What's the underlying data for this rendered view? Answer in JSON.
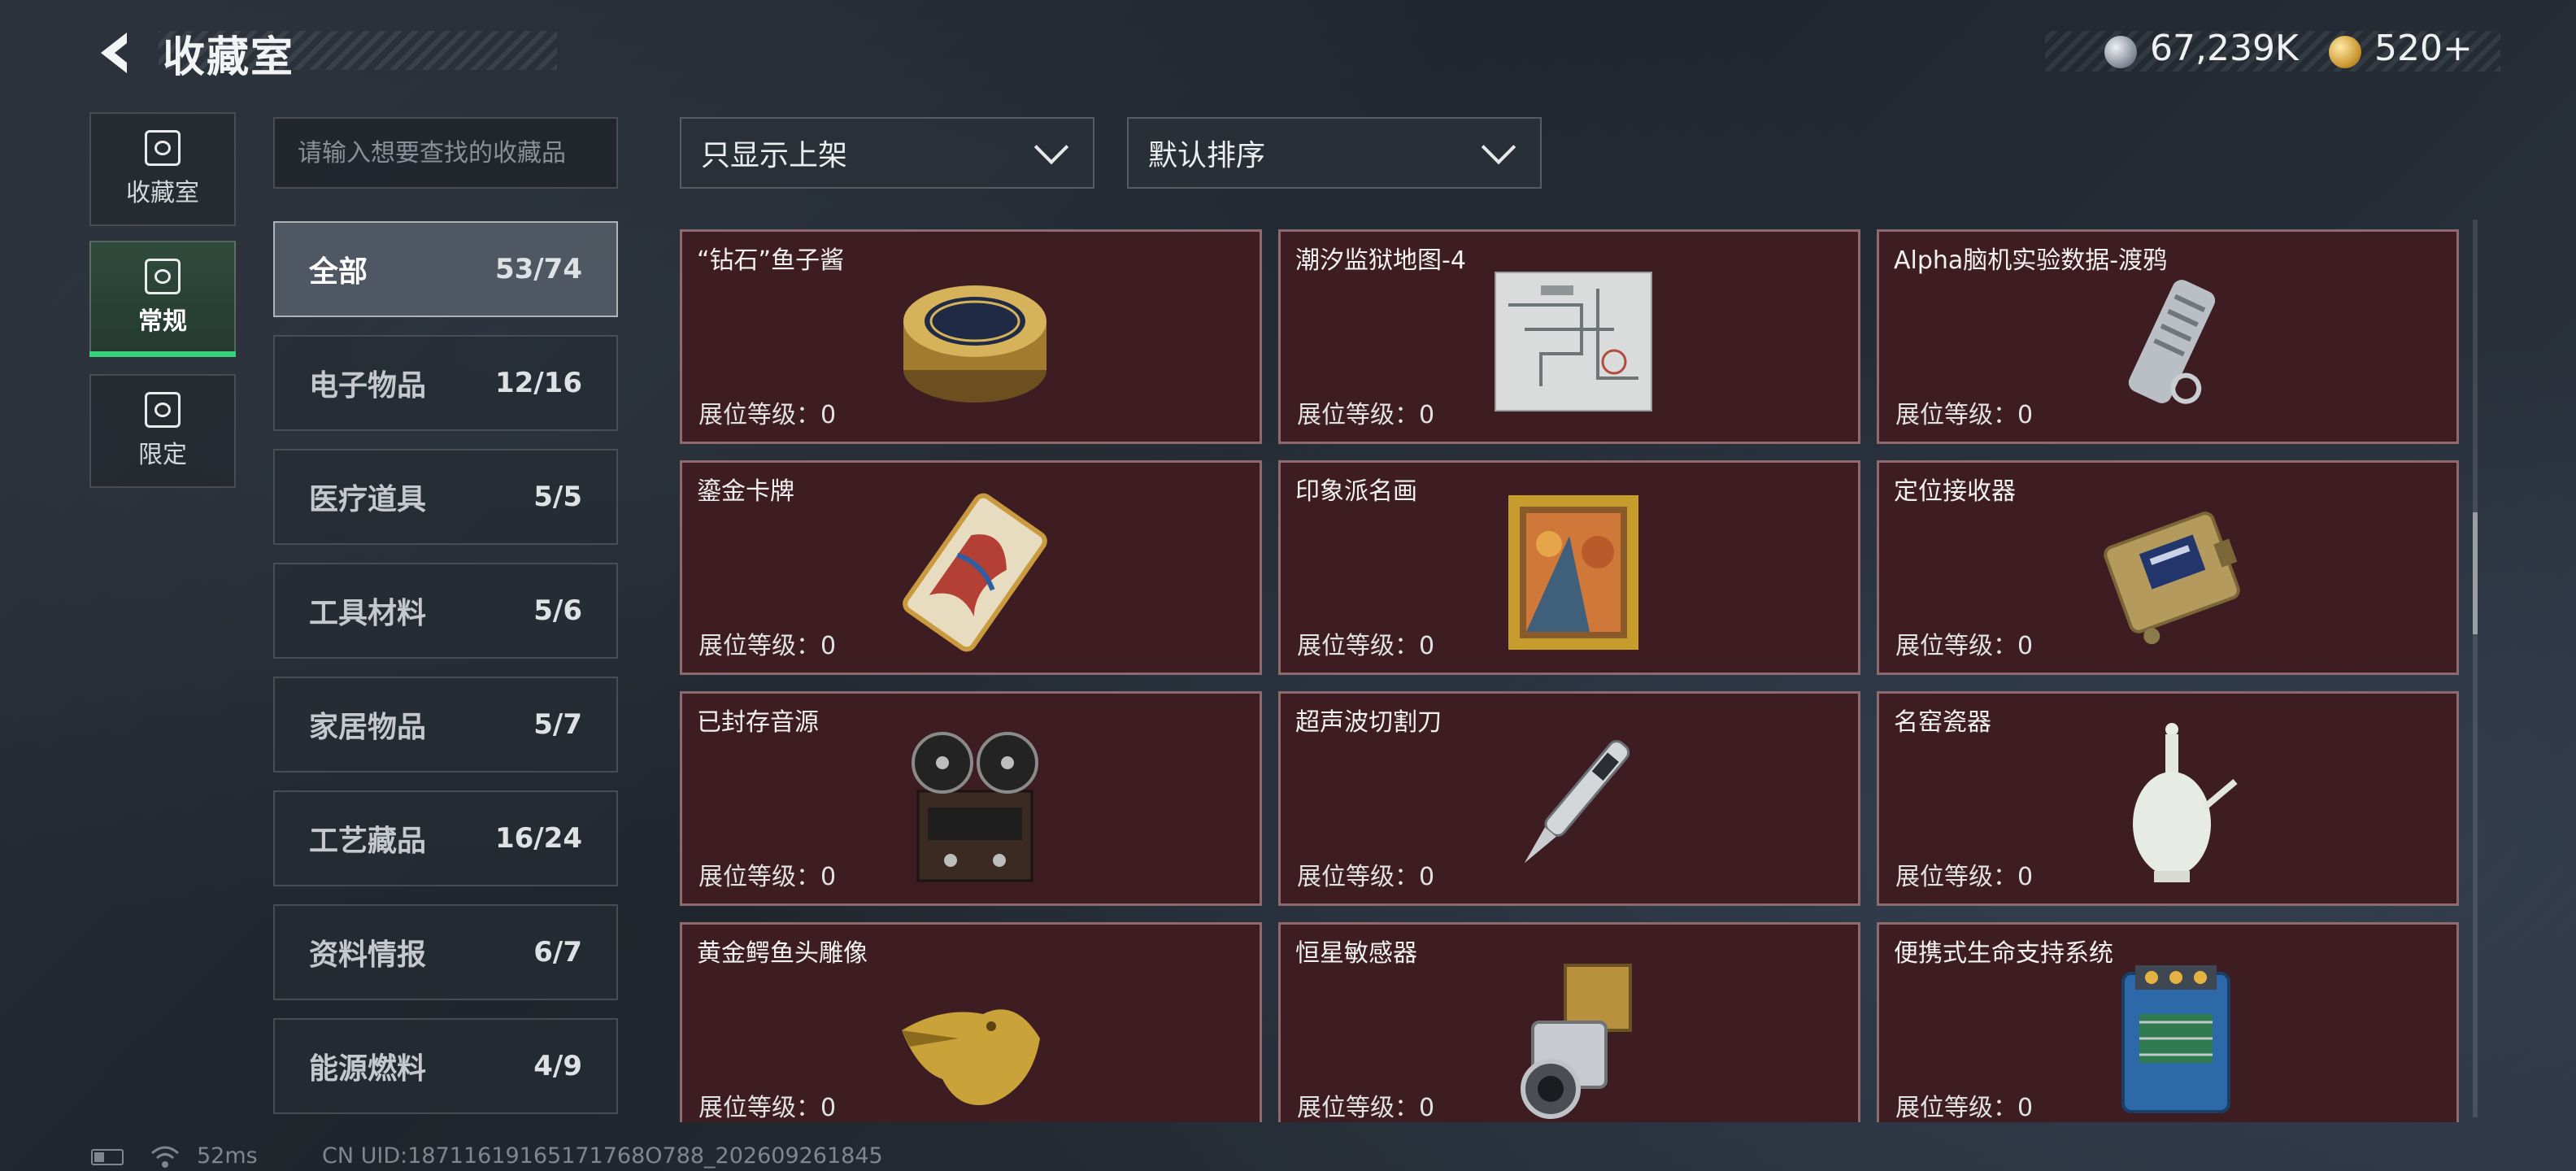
{
  "header": {
    "title": "收藏室",
    "currency": [
      {
        "icon": "silver-coin-icon",
        "value": "67,239K"
      },
      {
        "icon": "gold-coin-icon",
        "value": "520+"
      }
    ]
  },
  "nav": {
    "items": [
      {
        "label": "收藏室",
        "icon": "collection-room-icon"
      },
      {
        "label": "常规",
        "icon": "regular-icon",
        "active": true
      },
      {
        "label": "限定",
        "icon": "limited-icon"
      }
    ]
  },
  "search": {
    "placeholder": "请输入想要查找的收藏品",
    "value": ""
  },
  "filters": {
    "shelf": "只显示上架",
    "sort": "默认排序"
  },
  "categories": [
    {
      "name": "全部",
      "count": "53/74",
      "active": true
    },
    {
      "name": "电子物品",
      "count": "12/16"
    },
    {
      "name": "医疗道具",
      "count": "5/5"
    },
    {
      "name": "工具材料",
      "count": "5/6"
    },
    {
      "name": "家居物品",
      "count": "5/7"
    },
    {
      "name": "工艺藏品",
      "count": "16/24"
    },
    {
      "name": "资料情报",
      "count": "6/7"
    },
    {
      "name": "能源燃料",
      "count": "4/9"
    }
  ],
  "items": [
    {
      "name": "“钻石”鱼子酱",
      "level": "展位等级：0",
      "art": "caviar-tin-icon"
    },
    {
      "name": "潮汐监狱地图-4",
      "level": "展位等级：0",
      "art": "prison-map-icon"
    },
    {
      "name": "Alpha脑机实验数据-渡鸦",
      "level": "展位等级：0",
      "art": "data-drive-icon"
    },
    {
      "name": "鎏金卡牌",
      "level": "展位等级：0",
      "art": "gilded-card-icon"
    },
    {
      "name": "印象派名画",
      "level": "展位等级：0",
      "art": "painting-icon"
    },
    {
      "name": "定位接收器",
      "level": "展位等级：0",
      "art": "locator-receiver-icon"
    },
    {
      "name": "已封存音源",
      "level": "展位等级：0",
      "art": "reel-recorder-icon"
    },
    {
      "name": "超声波切割刀",
      "level": "展位等级：0",
      "art": "ultrasonic-cutter-icon"
    },
    {
      "name": "名窑瓷器",
      "level": "展位等级：0",
      "art": "porcelain-vase-icon"
    },
    {
      "name": "黄金鳄鱼头雕像",
      "level": "展位等级：0",
      "art": "gold-crocodile-icon"
    },
    {
      "name": "恒星敏感器",
      "level": "展位等级：0",
      "art": "star-sensor-icon"
    },
    {
      "name": "便携式生命支持系统",
      "level": "展位等级：0",
      "art": "life-support-icon"
    }
  ],
  "status": {
    "ping": "52ms",
    "uid": "CN UID:18711619165171768O788_202609261845"
  }
}
